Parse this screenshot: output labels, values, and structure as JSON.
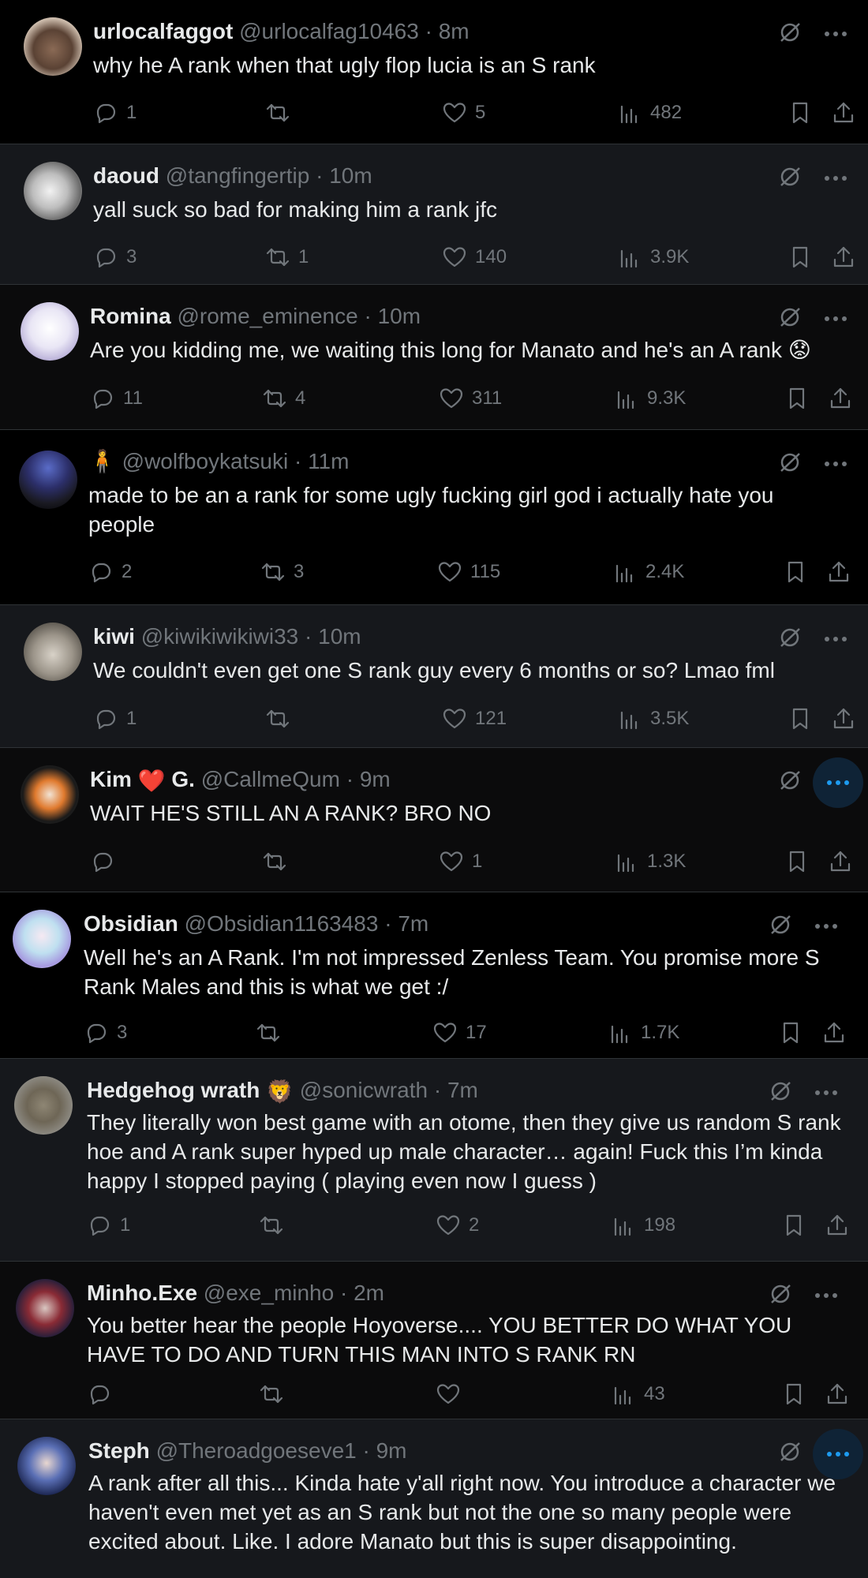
{
  "colors": {
    "background": "#000000",
    "alt_background": "#16181c",
    "text": "#e7e9ea",
    "muted": "#71767b",
    "accent": "#1d9bf0",
    "border": "#2f3336"
  },
  "tweets": [
    {
      "name": "urlocalfaggot",
      "handle": "@urlocalfag10463",
      "time": "8m",
      "text": "why he A rank when that ugly flop lucia is an S rank",
      "replies": "1",
      "reposts": "",
      "likes": "5",
      "views": "482",
      "avatar_icon": "hedgehog-avatar"
    },
    {
      "name": "daoud",
      "handle": "@tangfingertip",
      "time": "10m",
      "text": "yall suck so bad for making him a rank jfc",
      "replies": "3",
      "reposts": "1",
      "likes": "140",
      "views": "3.9K",
      "avatar_icon": "sketch-avatar"
    },
    {
      "name": "Romina",
      "handle": "@rome_eminence",
      "time": "10m",
      "text": "Are you kidding me, we waiting this long for Manato and he's an A rank 😟",
      "replies": "11",
      "reposts": "4",
      "likes": "311",
      "views": "9.3K",
      "avatar_icon": "anime-avatar"
    },
    {
      "name": "🧍",
      "handle": "@wolfboykatsuki",
      "time": "11m",
      "text": "made to be an a rank for some ugly fucking girl god i actually hate you people",
      "replies": "2",
      "reposts": "3",
      "likes": "115",
      "views": "2.4K",
      "avatar_icon": "anime-boy-avatar"
    },
    {
      "name": "kiwi",
      "handle": "@kiwikiwikiwi33",
      "time": "10m",
      "text": "We couldn't even get one S rank guy every 6 months or so? Lmao fml",
      "replies": "1",
      "reposts": "",
      "likes": "121",
      "views": "3.5K",
      "avatar_icon": "creature-avatar"
    },
    {
      "name": "Kim",
      "name_emoji": "❤️",
      "name_suffix": "G.",
      "handle": "@CallmeQum",
      "time": "9m",
      "text": "WAIT HE'S STILL AN A RANK? BRO NO",
      "replies": "",
      "reposts": "",
      "likes": "1",
      "views": "1.3K",
      "avatar_icon": "anime-girl-avatar"
    },
    {
      "name": "Obsidian",
      "handle": "@Obsidian1163483",
      "time": "7m",
      "text": "Well he's an A Rank. I'm not impressed Zenless Team. You promise more S Rank Males and this is what we get :/",
      "replies": "3",
      "reposts": "",
      "likes": "17",
      "views": "1.7K",
      "avatar_icon": "pastel-anime-avatar"
    },
    {
      "name": "Hedgehog wrath",
      "name_emoji": "🦁",
      "handle": "@sonicwrath",
      "time": "7m",
      "text": "They literally won best game with an otome, then they give us random S rank hoe and A rank super hyped up male character… again! Fuck this I’m kinda happy I stopped paying ( playing even now I guess )",
      "replies": "1",
      "reposts": "",
      "likes": "2",
      "views": "198",
      "avatar_icon": "hedgehog-photo-avatar"
    },
    {
      "name": "Minho.Exe",
      "handle": "@exe_minho",
      "time": "2m",
      "text": "You better hear the people Hoyoverse.... YOU BETTER DO WHAT YOU HAVE TO DO AND TURN THIS MAN INTO S RANK RN",
      "replies": "",
      "reposts": "",
      "likes": "",
      "views": "43",
      "avatar_icon": "mask-avatar"
    },
    {
      "name": "Steph",
      "handle": "@Theroadgoeseve1",
      "time": "9m",
      "text": "A rank after all this... Kinda hate y'all right now. You introduce a character we haven't even met yet as an S rank but not the one so many people were excited about. Like. I adore Manato but this is super disappointing.",
      "replies": "",
      "reposts": "",
      "likes": "",
      "views": "",
      "avatar_icon": "idol-avatar"
    }
  ]
}
